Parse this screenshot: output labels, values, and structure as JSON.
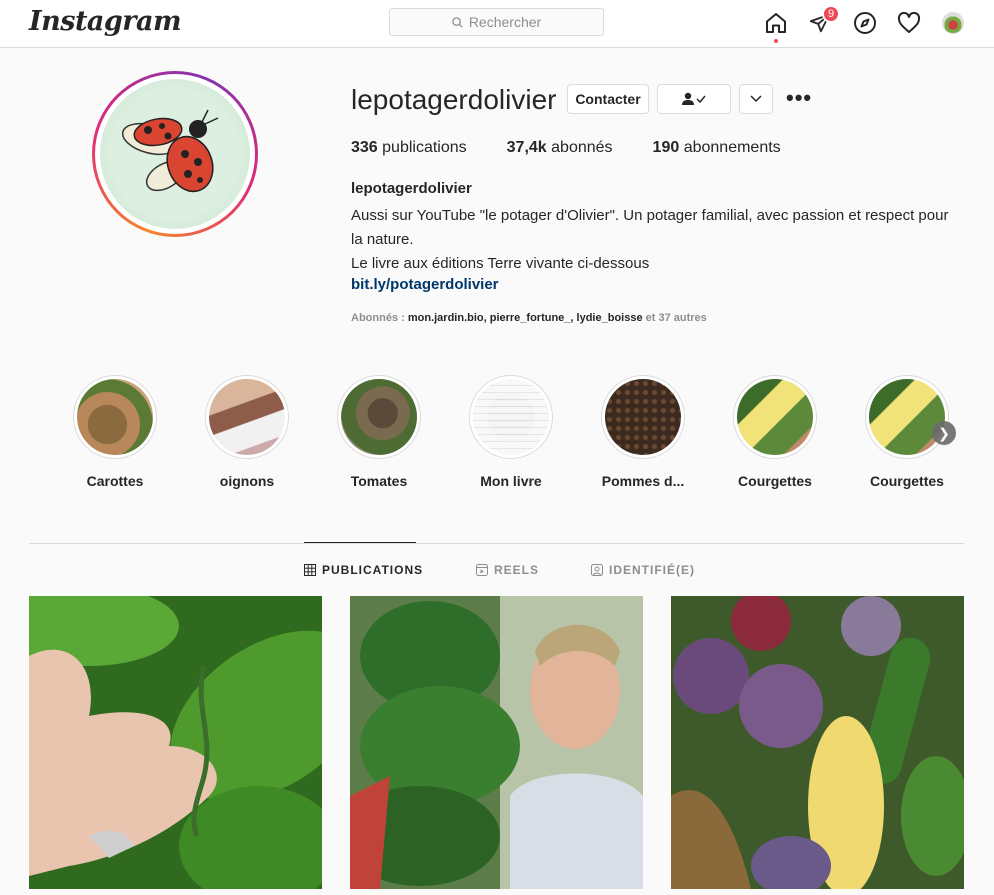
{
  "app": {
    "logo": "Instagram"
  },
  "search": {
    "placeholder": "Rechercher"
  },
  "nav": {
    "notifications_count": "9",
    "icons": [
      "home-icon",
      "direct-icon",
      "explore-icon",
      "activity-heart-icon",
      "avatar"
    ]
  },
  "profile": {
    "username": "lepotagerdolivier",
    "contact_label": "Contacter",
    "stats": [
      {
        "count": "336",
        "label": " publications"
      },
      {
        "count": "37,4k",
        "label": " abonnés"
      },
      {
        "count": "190",
        "label": " abonnements"
      }
    ],
    "bio_name": "lepotagerdolivier",
    "bio_lines": [
      "Aussi sur YouTube \"le potager d'Olivier\". Un potager familial, avec passion et respect pour la nature.",
      "Le livre aux éditions Terre vivante ci-dessous"
    ],
    "bio_link": "bit.ly/potagerdolivier",
    "followed_by_prefix": "Abonnés : ",
    "followed_by_names": "mon.jardin.bio, pierre_fortune_, lydie_boisse",
    "followed_by_suffix": " et 37 autres"
  },
  "highlights": [
    {
      "label": "Carottes"
    },
    {
      "label": "oignons"
    },
    {
      "label": "Tomates"
    },
    {
      "label": "Mon livre"
    },
    {
      "label": "Pommes d..."
    },
    {
      "label": "Courgettes"
    },
    {
      "label": "Courgettes"
    }
  ],
  "tabs": [
    {
      "label": "PUBLICATIONS",
      "active": true
    },
    {
      "label": "REELS",
      "active": false
    },
    {
      "label": "IDENTIFIÉ(E)",
      "active": false
    }
  ],
  "colors": {
    "accent_link": "#00376b",
    "badge": "#ed4956",
    "border": "#dbdbdb"
  }
}
